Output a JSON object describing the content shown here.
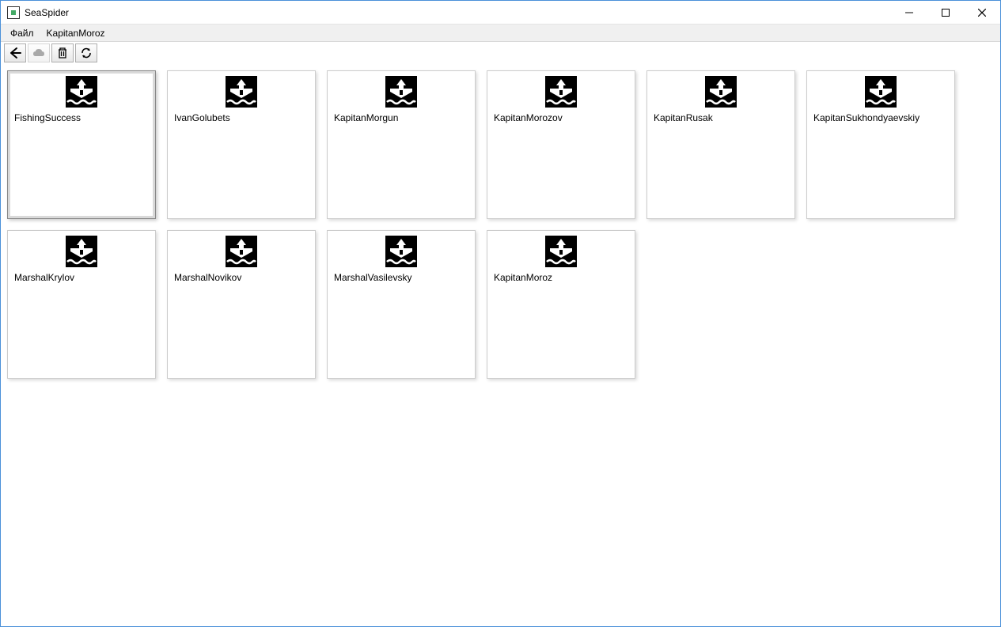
{
  "window": {
    "title": "SeaSpider"
  },
  "menu": {
    "items": [
      {
        "label": "Файл"
      },
      {
        "label": "KapitanMoroz"
      }
    ]
  },
  "toolbar": {
    "back": {
      "name": "back-button",
      "enabled": true
    },
    "cloud": {
      "name": "cloud-button",
      "enabled": false
    },
    "delete": {
      "name": "delete-button",
      "enabled": true
    },
    "refresh": {
      "name": "refresh-button",
      "enabled": true
    }
  },
  "tiles": [
    {
      "label": "FishingSuccess",
      "selected": true
    },
    {
      "label": "IvanGolubets",
      "selected": false
    },
    {
      "label": "KapitanMorgun",
      "selected": false
    },
    {
      "label": "KapitanMorozov",
      "selected": false
    },
    {
      "label": "KapitanRusak",
      "selected": false
    },
    {
      "label": "KapitanSukhondyaevskiy",
      "selected": false
    },
    {
      "label": "MarshalKrylov",
      "selected": false
    },
    {
      "label": "MarshalNovikov",
      "selected": false
    },
    {
      "label": "MarshalVasilevsky",
      "selected": false
    },
    {
      "label": "KapitanMoroz",
      "selected": false
    }
  ]
}
